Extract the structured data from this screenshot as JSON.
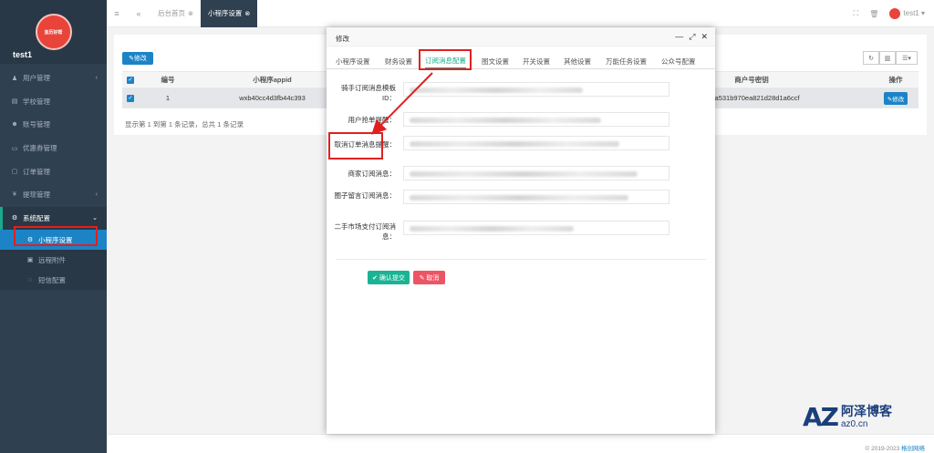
{
  "sidebar": {
    "logo_text": "亚历好帮",
    "username": "test1",
    "items": [
      {
        "icon": "user-icon",
        "glyph": "♟",
        "label": "用户管理",
        "arrow": "‹"
      },
      {
        "icon": "school-icon",
        "glyph": "▤",
        "label": "学校管理",
        "arrow": ""
      },
      {
        "icon": "users-icon",
        "glyph": "☻",
        "label": "账号管理",
        "arrow": ""
      },
      {
        "icon": "coupon-icon",
        "glyph": "▭",
        "label": "优惠券管理",
        "arrow": ""
      },
      {
        "icon": "order-icon",
        "glyph": "▢",
        "label": "订单管理",
        "arrow": ""
      },
      {
        "icon": "yen-icon",
        "glyph": "¥",
        "label": "提现管理",
        "arrow": "‹"
      },
      {
        "icon": "gear-icon",
        "glyph": "⚙",
        "label": "系统配置",
        "arrow": "⌄"
      }
    ],
    "subitems": [
      {
        "icon": "gear-icon",
        "glyph": "⚙",
        "label": "小程序设置"
      },
      {
        "icon": "file-icon",
        "glyph": "▣",
        "label": "远程附件"
      },
      {
        "icon": "chat-icon",
        "glyph": "◌",
        "label": "短信配置"
      }
    ]
  },
  "topbar": {
    "menu_glyph": "≡",
    "back_glyph": "«",
    "tabs": [
      {
        "label": "后台首页",
        "close": "⊗"
      },
      {
        "label": "小程序设置",
        "close": "⊗"
      }
    ],
    "fullscreen_glyph": "⛶",
    "trash_glyph": "🗑",
    "user": "test1",
    "caret": "▾"
  },
  "panel": {
    "edit_label": "✎修改",
    "tool_refresh": "↻",
    "tool_columns": "▥",
    "tool_list": "☰▾",
    "headers": {
      "id": "编号",
      "appid": "小程序appid",
      "secret": "商户号密钥",
      "op": "操作"
    },
    "row": {
      "id": "1",
      "appid": "wxb40cc4d3fb44c393",
      "secret": "dc1a531b970ea821d28d1a6ccf",
      "edit": "✎修改"
    },
    "page_info": "显示第 1 到第 1 条记录，总共 1 条记录"
  },
  "modal": {
    "title": "修改",
    "minimize": "—",
    "maximize": "⤢",
    "close": "✕",
    "tabs": [
      "小程序设置",
      "财务设置",
      "订阅消息配置",
      "图文设置",
      "开关设置",
      "其他设置",
      "万能任务设置",
      "公众号配置"
    ],
    "fields": [
      {
        "label": "骑手订阅消息模板ID："
      },
      {
        "label": "用户抢单提醒："
      },
      {
        "label": "取消订单消息提醒："
      },
      {
        "label": "商家订阅消息："
      },
      {
        "label": "圈子留言订阅消息："
      },
      {
        "label": "二手市场支付订阅消息："
      }
    ],
    "confirm_label": "✔ 确认提交",
    "cancel_label": "✎ 取消"
  },
  "footer": {
    "copyright": "© 2019-2023 ",
    "brand": "格创网络"
  },
  "watermark": {
    "az": "AZ",
    "cn": "阿泽博客",
    "url": "az0.cn"
  },
  "colors": {
    "sidebar_bg": "#2f4050",
    "accent_blue": "#1c84c6",
    "accent_green": "#1ab394",
    "danger": "#ed5565",
    "highlight_red": "#e02020"
  }
}
